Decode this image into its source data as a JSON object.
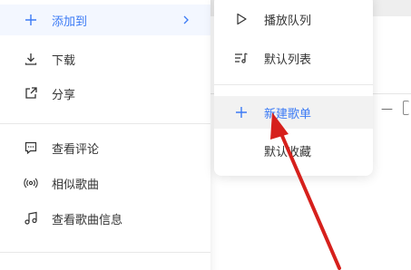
{
  "primary_menu": {
    "items": [
      {
        "label": "添加到",
        "icon": "plus-icon",
        "active": true,
        "has_submenu": true
      },
      {
        "label": "下载",
        "icon": "download-icon"
      },
      {
        "label": "分享",
        "icon": "share-icon"
      },
      {
        "label": "查看评论",
        "icon": "comment-icon"
      },
      {
        "label": "相似歌曲",
        "icon": "radio-waves-icon"
      },
      {
        "label": "查看歌曲信息",
        "icon": "music-note-icon"
      }
    ]
  },
  "submenu": {
    "items": [
      {
        "label": "播放队列",
        "icon": "play-icon"
      },
      {
        "label": "默认列表",
        "icon": "playlist-icon"
      },
      {
        "label": "新建歌单",
        "icon": "plus-icon",
        "hover": true
      },
      {
        "label": "默认收藏"
      }
    ]
  },
  "colors": {
    "accent": "#3c7bf5",
    "text": "#333333",
    "arrow": "#d6201c"
  }
}
